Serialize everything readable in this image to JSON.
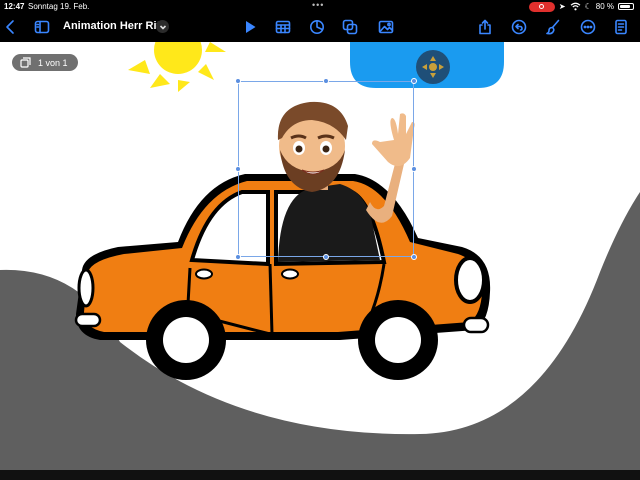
{
  "status_bar": {
    "time": "12:47",
    "date": "Sonntag 19. Feb.",
    "battery": "80 %",
    "battery_level": 0.8
  },
  "toolbar": {
    "title": "Animation Herr Ritt",
    "accent_color": "#3a86ff",
    "icons": [
      "back-chevron-icon",
      "sidebar-icon",
      "title-chevron-icon",
      "play-icon",
      "table-icon",
      "chart-icon",
      "shapes-icon",
      "media-icon",
      "share-icon",
      "undo-icon",
      "format-brush-icon",
      "more-icon",
      "document-icon"
    ]
  },
  "canvas": {
    "slide_counter": "1 von 1",
    "colors": {
      "sky": "#ffffff",
      "hill": "#5f5f5f",
      "cloud": "#1a9bf0",
      "sun": "#ffe81a",
      "car_body": "#f07e12",
      "selection": "#5b8fe0"
    }
  }
}
